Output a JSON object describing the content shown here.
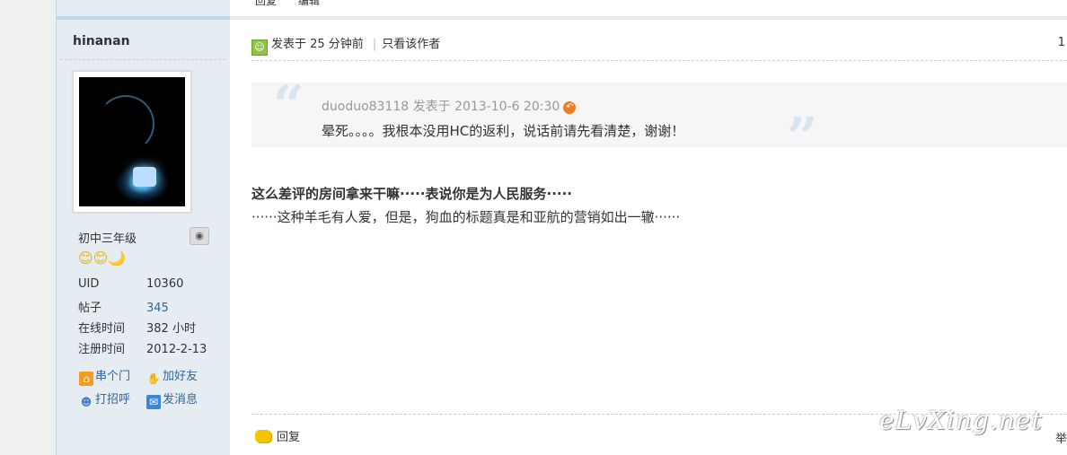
{
  "previous_post": {
    "reply_label": "回复",
    "edit_label": "编辑"
  },
  "user": {
    "username": "hinanan",
    "rank": "初中三年级",
    "stars": "😊😊🌙",
    "stats": [
      {
        "label": "UID",
        "value": "10360"
      },
      {
        "label": "帖子",
        "value": "345"
      },
      {
        "label": "在线时间",
        "value": "382 小时"
      },
      {
        "label": "注册时间",
        "value": "2012-2-13"
      }
    ],
    "links": [
      {
        "label": "串个门",
        "icon": "home-icon"
      },
      {
        "label": "加好友",
        "icon": "handshake-icon"
      },
      {
        "label": "打招呼",
        "icon": "greet-icon"
      },
      {
        "label": "发消息",
        "icon": "message-icon"
      }
    ]
  },
  "post": {
    "posted_label": "发表于 25 分钟前",
    "only_author": "只看该作者",
    "floor": "1",
    "quote": {
      "meta": "duoduo83118 发表于 2013-10-6 20:30",
      "text": "晕死。。。。我根本没用HC的返利，说话前请先看清楚，谢谢！"
    },
    "body_bold": "这么差评的房间拿来干嘛·····表说你是为人民服务·····",
    "body_text": "······这种羊毛有人爱，但是，狗血的标题真是和亚航的营销如出一辙······",
    "reply_label": "回复",
    "report_label": "举",
    "watermark": "eLvXing.net"
  }
}
